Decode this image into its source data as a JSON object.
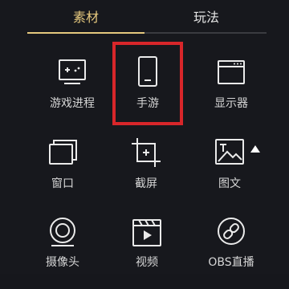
{
  "tabs": {
    "active": "素材",
    "inactive": "玩法"
  },
  "items": [
    {
      "label": "游戏进程",
      "icon": "game-icon"
    },
    {
      "label": "手游",
      "icon": "phone-icon"
    },
    {
      "label": "显示器",
      "icon": "monitor-window-icon"
    },
    {
      "label": "窗口",
      "icon": "window-icon"
    },
    {
      "label": "截屏",
      "icon": "screenshot-icon"
    },
    {
      "label": "图文",
      "icon": "image-text-icon"
    },
    {
      "label": "摄像头",
      "icon": "camera-icon"
    },
    {
      "label": "视频",
      "icon": "video-icon"
    },
    {
      "label": "OBS直播",
      "icon": "link-icon"
    }
  ],
  "colors": {
    "accent": "#e5c87e",
    "highlight": "#d8262a",
    "background": "#17181d"
  }
}
